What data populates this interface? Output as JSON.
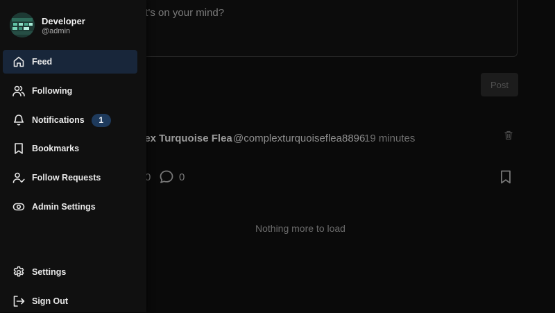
{
  "composer": {
    "placeholder_visible": "at's on your mind?",
    "post_button": "Post"
  },
  "post": {
    "author_name_visible": "plex Turquoise Flea",
    "author_handle": "@complexturquoiseflea8896",
    "time": "19 minutes",
    "likes_count_visible": "0",
    "comments_count": "0"
  },
  "feed_end_text": "Nothing more to load",
  "sidebar": {
    "profile": {
      "name": "Developer",
      "handle": "@admin"
    },
    "items": [
      {
        "label": "Feed",
        "icon": "home-icon",
        "active": true
      },
      {
        "label": "Following",
        "icon": "users-icon"
      },
      {
        "label": "Notifications",
        "icon": "bell-icon",
        "badge": "1"
      },
      {
        "label": "Bookmarks",
        "icon": "bookmark-icon"
      },
      {
        "label": "Follow Requests",
        "icon": "user-check-icon"
      },
      {
        "label": "Admin Settings",
        "icon": "eye-icon"
      }
    ],
    "bottom_items": [
      {
        "label": "Settings",
        "icon": "gear-icon"
      },
      {
        "label": "Sign Out",
        "icon": "sign-out-icon"
      }
    ]
  },
  "colors": {
    "background": "#0a0a0a",
    "sidebar": "#101010",
    "active_item": "#18263a",
    "badge": "#1e3a5c"
  }
}
